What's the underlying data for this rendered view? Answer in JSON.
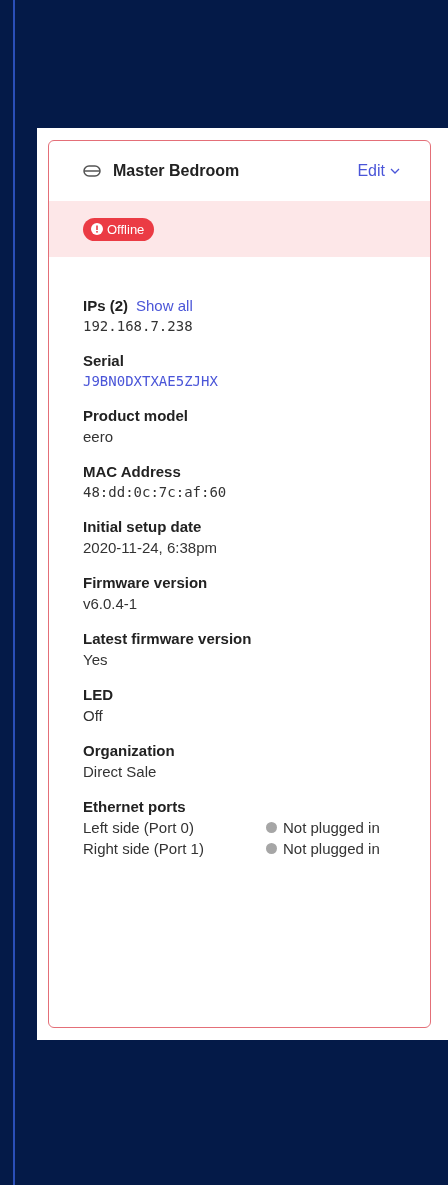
{
  "device": {
    "name": "Master Bedroom",
    "edit_label": "Edit",
    "status": {
      "label": "Offline",
      "kind": "offline"
    }
  },
  "fields": [
    {
      "label": "IPs (2)",
      "action": "Show all",
      "value": "192.168.7.238",
      "kind": "mono"
    },
    {
      "label": "Serial",
      "value": "J9BN0DXTXAE5ZJHX",
      "kind": "mono-link"
    },
    {
      "label": "Product model",
      "value": "eero",
      "kind": "text"
    },
    {
      "label": "MAC Address",
      "value": "48:dd:0c:7c:af:60",
      "kind": "mono"
    },
    {
      "label": "Initial setup date",
      "value": "2020-11-24, 6:38pm",
      "kind": "text"
    },
    {
      "label": "Firmware version",
      "value": "v6.0.4-1",
      "kind": "text"
    },
    {
      "label": "Latest firmware version",
      "value": "Yes",
      "kind": "text"
    },
    {
      "label": "LED",
      "value": "Off",
      "kind": "text"
    },
    {
      "label": "Organization",
      "value": "Direct Sale",
      "kind": "text"
    }
  ],
  "ethernet": {
    "label": "Ethernet ports",
    "ports": [
      {
        "name": "Left side (Port 0)",
        "status": "Not plugged in",
        "color": "#a6a6a6"
      },
      {
        "name": "Right side (Port 1)",
        "status": "Not plugged in",
        "color": "#a6a6a6"
      }
    ]
  }
}
